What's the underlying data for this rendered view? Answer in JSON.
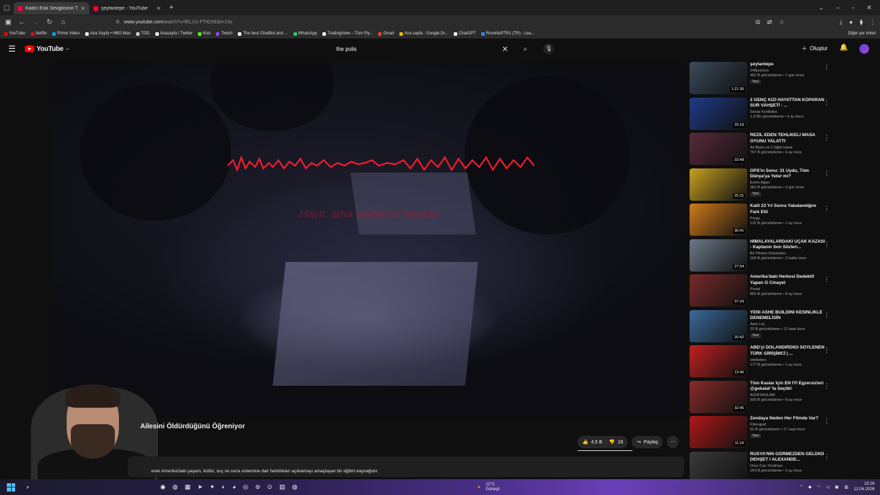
{
  "browser": {
    "tabs": [
      {
        "title": "Kadın Eski Sevgilisinin Tüm",
        "active": true
      },
      {
        "title": "şeytantepe - YouTube",
        "active": false
      }
    ],
    "url_domain": "www.youtube.com",
    "url_path": "/watch?v=fELU1-FTIGXE&t=15s",
    "bookmarks": [
      {
        "label": "YouTube",
        "color": "#ff0000"
      },
      {
        "label": "Netflix",
        "color": "#e50914"
      },
      {
        "label": "Prime Video",
        "color": "#00a8e1"
      },
      {
        "label": "Ana Sayfa • HBO Max",
        "color": "#ffffff"
      },
      {
        "label": "TOD",
        "color": "#cccccc"
      },
      {
        "label": "Anasayfa / Twitter",
        "color": "#ffffff"
      },
      {
        "label": "Kick",
        "color": "#53fc18"
      },
      {
        "label": "Twitch",
        "color": "#9146ff"
      },
      {
        "label": "The best ChatBot and ...",
        "color": "#ffffff"
      },
      {
        "label": "WhatsApp",
        "color": "#25d366"
      },
      {
        "label": "TradingView – Tüm Piy...",
        "color": "#ffffff"
      },
      {
        "label": "Gmail",
        "color": "#ea4335"
      },
      {
        "label": "Ana sayfa - Google Dr...",
        "color": "#fbbc04"
      },
      {
        "label": "ChatGPT",
        "color": "#ffffff"
      },
      {
        "label": "Rosetta®TR1 (TR) - Lea...",
        "color": "#2d8cff"
      }
    ],
    "bookmarks_other": "Diğer yer imleri"
  },
  "header": {
    "logo": "YouTube",
    "logo_sup": "TR",
    "search_query": "the polis",
    "create_label": "Oluştur"
  },
  "video": {
    "overlay_text": "Hayır, ama şeytanlar burada",
    "title": "Ailesini Öldürdüğünü Öğreniyor",
    "likes": "4,5 B",
    "dislikes": "16",
    "share_label": "Paylaş",
    "description": "erek Amerika'daki yaşam, kültür, suç ve ceza sistemine dair farklılıkları açıklamayı amaçlayan bir eğitim kaynağıdır."
  },
  "recommendations": [
    {
      "title": "şeytantepe",
      "channel": "140journos",
      "stats": "402 B görüntüleme • 1 gün önce",
      "duration": "1:21:30",
      "badge": "Yeni",
      "thumb": "#3b4a5c"
    },
    {
      "title": "2 GENÇ KIZI HAYATTAN KOPARAN SUR VAHŞETİ - ...",
      "channel": "Savaş Kurtbaba",
      "stats": "1,9 Mn görüntüleme • 4 ay önce",
      "duration": "33:19",
      "badge": "",
      "thumb": "#1f3b8a"
    },
    {
      "title": "REZİL EDEN TEHLİKELİ MASA OYUNU YALATTI",
      "channel": "Ali Biçim ve 2 diğer kanal",
      "stats": "767 B görüntüleme • 6 ay önce",
      "duration": "33:48",
      "badge": "",
      "thumb": "#5a2a3a"
    },
    {
      "title": "GPS'in Sonu: 31 Uydu, Tüm Dünya'ya Yeter mi?",
      "channel": "Evrim Ağacı",
      "stats": "383 B görüntüleme • 2 gün önce",
      "duration": "25:31",
      "badge": "Yeni",
      "thumb": "#c8a020"
    },
    {
      "title": "Katil 23 Yıl Sonra Yakalandığını Fark Etti",
      "channel": "Purgy",
      "stats": "132 B görüntüleme • 1 ay önce",
      "duration": "30:41",
      "badge": "",
      "thumb": "#d07a1a"
    },
    {
      "title": "HİMALAYALARDAKİ UÇAK KAZASI - Kaptanın Son Sözleri...",
      "channel": "Bir Pilotun Gözünden",
      "stats": "168 B görüntüleme • 2 hafta önce",
      "duration": "27:54",
      "badge": "",
      "thumb": "#6c7a8a"
    },
    {
      "title": "Amerika'daki Herkesi Dedektif Yapan O Cinayet",
      "channel": "Portal",
      "stats": "856 B görüntüleme • 6 ay önce",
      "duration": "37:24",
      "badge": "",
      "thumb": "#7a2a2a"
    },
    {
      "title": "YENİ ASHE BUILDİNİ KESİNLİKLE DENEMELİSİN",
      "channel": "Adro LoL",
      "stats": "33 B görüntüleme • 12 saat önce",
      "duration": "20:42",
      "badge": "Yeni",
      "thumb": "#3a6a9a"
    },
    {
      "title": "ABD'yi DOLANDIRDIĞI SÖYLENEN TÜRK GİRİŞİMCİ | ...",
      "channel": "webtekno",
      "stats": "177 B görüntüleme • 1 ay önce",
      "duration": "13:46",
      "badge": "",
      "thumb": "#c02020"
    },
    {
      "title": "Tüm Kaslar İçin EN İYİ Egzersizleri @gokalaf 'la Seçtik!",
      "channel": "AĞIRSAĞLAM",
      "stats": "599 B görüntüleme • 8 ay önce",
      "duration": "32:45",
      "badge": "",
      "thumb": "#8a2a2a"
    },
    {
      "title": "Zendaya Neden Her Filmde Var?",
      "channel": "Filmograf",
      "stats": "52 B görüntüleme • 17 saat önce",
      "duration": "11:14",
      "badge": "Yeni",
      "thumb": "#b01818"
    },
    {
      "title": "RUSYA'NIN GÖRMEZDEN GELDİĞİ DEHŞET I ALEXANDE...",
      "channel": "Onur Can Yenilmez",
      "stats": "254 B görüntüleme • 3 ay önce",
      "duration": "",
      "badge": "",
      "thumb": "#3a3a3a"
    }
  ],
  "taskbar": {
    "temp": "12°C",
    "weather": "Güneşli",
    "time": "13:16",
    "date": "12.04.2026"
  }
}
